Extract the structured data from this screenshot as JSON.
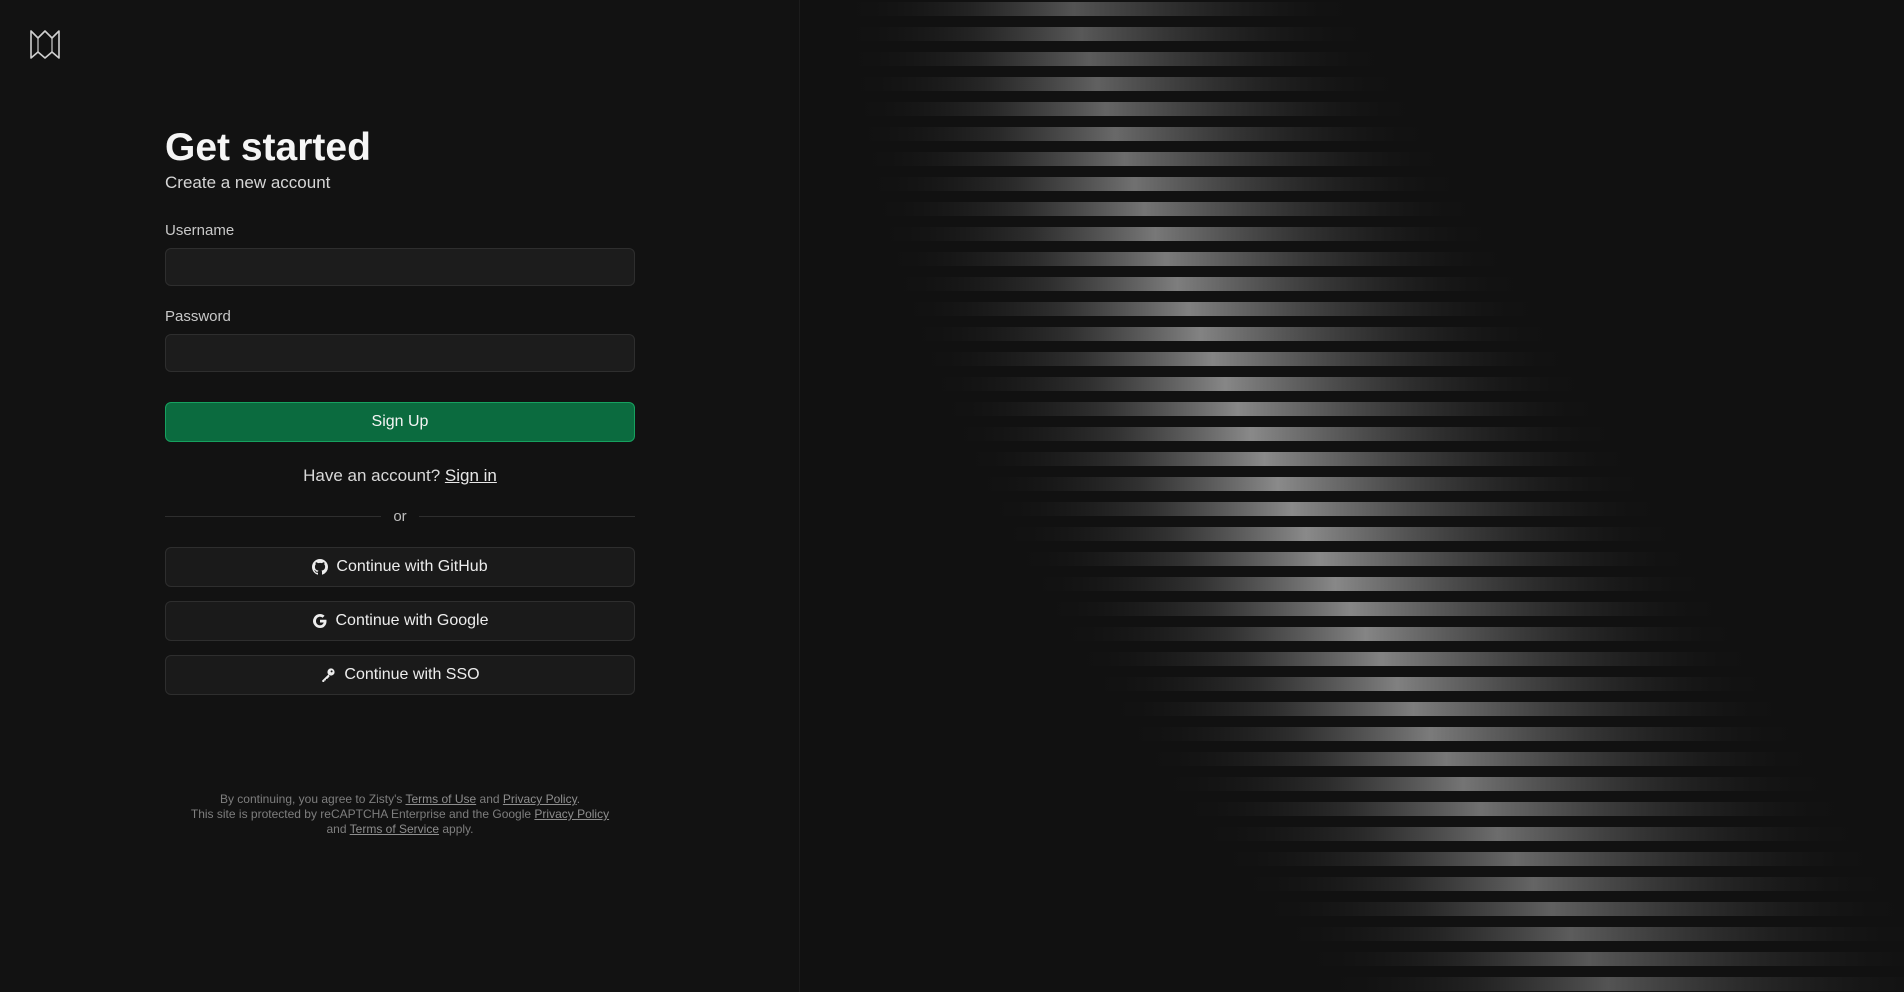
{
  "brand": {
    "logo_icon": "zisty-logo-icon"
  },
  "header": {
    "title": "Get started",
    "subtitle": "Create a new account"
  },
  "form": {
    "username_label": "Username",
    "username_value": "",
    "username_placeholder": "",
    "password_label": "Password",
    "password_value": "",
    "password_placeholder": "",
    "submit_label": "Sign Up"
  },
  "signin": {
    "prompt": "Have an account?",
    "link_label": "Sign in"
  },
  "divider": {
    "label": "or"
  },
  "social": {
    "github_label": "Continue with GitHub",
    "google_label": "Continue with Google",
    "sso_label": "Continue with SSO"
  },
  "legal": {
    "line1_prefix": "By continuing, you agree to Zisty's",
    "terms_of_use": "Terms of Use",
    "and1": "and",
    "privacy_policy": "Privacy Policy",
    "period": ".",
    "line2_prefix": "This site is protected by reCAPTCHA Enterprise and the Google",
    "google_privacy_policy": "Privacy Policy",
    "and2": "and",
    "terms_of_service": "Terms of Service",
    "line3_suffix": "apply."
  },
  "colors": {
    "background": "#121212",
    "primary_button": "#0b6b3f",
    "primary_border": "#16a15f",
    "input_bg": "#1c1c1c"
  }
}
